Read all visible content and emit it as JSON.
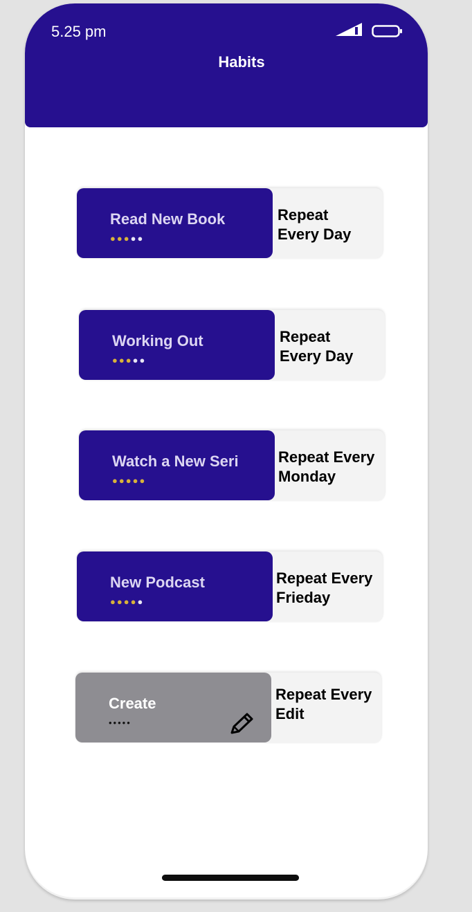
{
  "status_bar": {
    "time": "5.25 pm",
    "signal_icon": "signal-icon",
    "battery_icon": "battery-icon"
  },
  "header": {
    "title": "Habits"
  },
  "colors": {
    "primary": "#26108f",
    "card_grey": "#8e8d92",
    "dot_gold": "#d8b23a",
    "side_panel": "#f3f3f3"
  },
  "habits": [
    {
      "title": "Read New Book",
      "repeat_line1": "Repeat",
      "repeat_line2": "Every Day",
      "progress_filled": 3,
      "progress_total": 5
    },
    {
      "title": "Working Out",
      "repeat_line1": "Repeat",
      "repeat_line2": "Every Day",
      "progress_filled": 3,
      "progress_total": 5
    },
    {
      "title": "Watch a New Seri",
      "repeat_line1": "Repeat Every",
      "repeat_line2": "Monday",
      "progress_filled": 5,
      "progress_total": 5
    },
    {
      "title": "New Podcast",
      "repeat_line1": "Repeat Every",
      "repeat_line2": "Frieday",
      "progress_filled": 4,
      "progress_total": 5
    }
  ],
  "create_card": {
    "title": "Create",
    "repeat_line1": "Repeat Every",
    "repeat_line2": "Edit",
    "dots": "•••••",
    "edit_icon": "pencil-icon"
  }
}
